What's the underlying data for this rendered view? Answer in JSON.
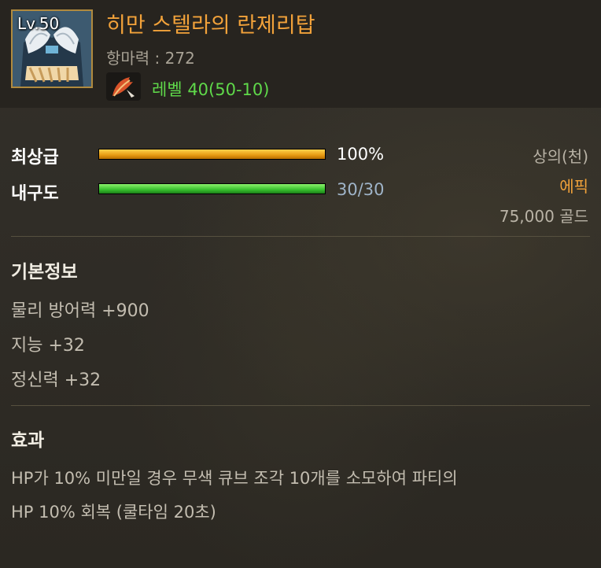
{
  "item": {
    "level_badge": "Lv.50",
    "name": "히만 스텔라의 란제리탑",
    "attack": "항마력 : 272",
    "level_requirement": "레벨 40(50-10)"
  },
  "stats": {
    "quality_label": "최상급",
    "quality_value": "100%",
    "quality_percent": 100,
    "durability_label": "내구도",
    "durability_value": "30/30",
    "durability_percent": 100
  },
  "meta": {
    "slot": "상의(천)",
    "rarity": "에픽",
    "price": "75,000 골드"
  },
  "basic_info": {
    "title": "기본정보",
    "lines": [
      "물리 방어력 +900",
      "지능 +32",
      "정신력 +32"
    ]
  },
  "effects": {
    "title": "효과",
    "lines": [
      "HP가 10% 미만일 경우 무색 큐브 조각 10개를 소모하여 파티의",
      "HP 10% 회복 (쿨타임 20초)"
    ]
  },
  "colors": {
    "item_name": "#f2a23a",
    "rarity_epic": "#f2a23a",
    "level_requirement": "#5fd94a",
    "durability_value": "#9fb4c8",
    "quality_bar": "#e79a12",
    "durability_bar": "#37c02e"
  },
  "icons": {
    "item": "lingerie-top-icon",
    "level": "feather-quill-icon"
  }
}
